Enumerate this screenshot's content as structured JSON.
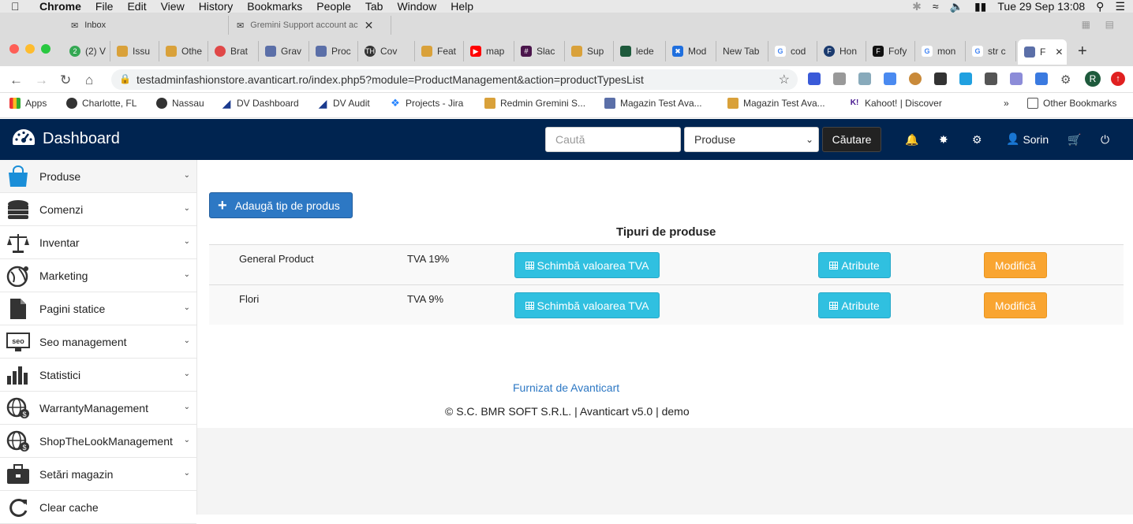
{
  "os_menubar": {
    "app": "Chrome",
    "menus": [
      "File",
      "Edit",
      "View",
      "History",
      "Bookmarks",
      "People",
      "Tab",
      "Window",
      "Help"
    ],
    "clock": "Tue 29 Sep  13:08"
  },
  "browser": {
    "top_tabs": [
      "Inbox",
      "Gremini Support account ac"
    ],
    "tabs": [
      "(2) V",
      "Issu",
      "Othe",
      "Brat",
      "Grav",
      "Proc",
      "Cov",
      "Feat",
      "map",
      "Slac",
      "Sup",
      "lede",
      "Mod",
      "New Tab",
      "cod",
      "Hon",
      "Fofy",
      "mon",
      "str c",
      "F"
    ],
    "url": "testadminfashionstore.avanticart.ro/index.php5?module=ProductManagement&action=productTypesList",
    "avatar_letter": "R",
    "bookmarks": [
      "Apps",
      "Charlotte, FL",
      "Nassau",
      "DV Dashboard",
      "DV Audit",
      "Projects - Jira",
      "Redmin Gremini S...",
      "Magazin Test Ava...",
      "Magazin Test Ava...",
      "Kahoot! | Discover"
    ],
    "other_bookmarks": "Other Bookmarks",
    "bm_more": "»"
  },
  "header": {
    "brand": "Dashboard",
    "search_placeholder": "Caută",
    "search_scope": "Produse",
    "search_button": "Căutare",
    "user": "Sorin"
  },
  "sidebar": {
    "items": [
      {
        "label": "Produse"
      },
      {
        "label": "Comenzi"
      },
      {
        "label": "Inventar"
      },
      {
        "label": "Marketing"
      },
      {
        "label": "Pagini statice"
      },
      {
        "label": "Seo management"
      },
      {
        "label": "Statistici"
      },
      {
        "label": "WarrantyManagement"
      },
      {
        "label": "ShopTheLookManagement"
      },
      {
        "label": "Setări magazin"
      },
      {
        "label": "Clear cache"
      }
    ],
    "seo_icon_text": "seo"
  },
  "main": {
    "add_button": "Adaugă tip de produs",
    "table_title": "Tipuri de produse",
    "rows": [
      {
        "name": "General Product",
        "vat": "TVA 19%",
        "change_vat": "Schimbă valoarea TVA",
        "attributes": "Atribute",
        "edit": "Modifică"
      },
      {
        "name": "Flori",
        "vat": "TVA 9%",
        "change_vat": "Schimbă valoarea TVA",
        "attributes": "Atribute",
        "edit": "Modifică"
      }
    ]
  },
  "footer": {
    "link": "Furnizat de Avanticart",
    "text": "© S.C. BMR SOFT S.R.L. | Avanticart v5.0 | demo"
  },
  "colors": {
    "navbar": "#002450",
    "primary": "#2d78c4",
    "info": "#30c0e0",
    "warning": "#f9a531"
  }
}
